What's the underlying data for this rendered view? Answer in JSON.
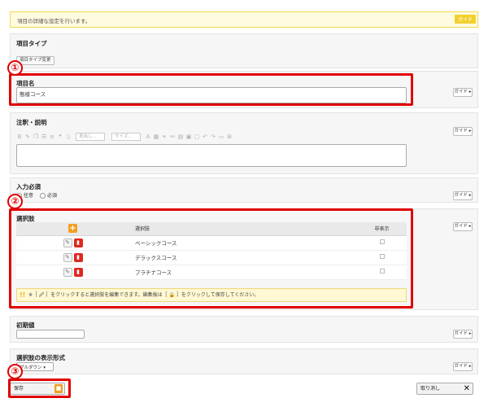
{
  "notice": {
    "text": "項目の詳細な設定を行います。",
    "guide": "ガイド"
  },
  "guide_label": "ガイド ▸",
  "sections": {
    "item_type": {
      "title": "項目タイプ",
      "change_button": "項目タイプ変更"
    },
    "item_name": {
      "title": "項目名",
      "value": "態様コース"
    },
    "annotation": {
      "title": "注釈・説明",
      "toolbar": {
        "style_select": "見出し...",
        "size_select": "サイズ..."
      }
    },
    "required": {
      "title": "入力必須",
      "options": [
        "任意",
        "必須"
      ]
    },
    "choices": {
      "title": "選択肢",
      "columns": [
        "選択肢",
        "非表示"
      ],
      "rows": [
        "ベーシックコース",
        "デラックスコース",
        "プラチナコース"
      ],
      "hint": "※［ 🖉 ］をクリックすると選択肢を編集できます。編集後は［ 🔒 ］をクリックして保存してください。"
    },
    "initial_value": {
      "title": "初期値",
      "value": ""
    },
    "display_format": {
      "title": "選択肢の表示形式",
      "select_value": "プルダウン"
    }
  },
  "markers": [
    "①",
    "②",
    "③"
  ],
  "footer": {
    "save": "保存",
    "cancel": "取り消し"
  },
  "colors": {
    "accent_red": "#e00000",
    "warning_yellow": "#f1d02e",
    "orange": "#f0a020"
  }
}
